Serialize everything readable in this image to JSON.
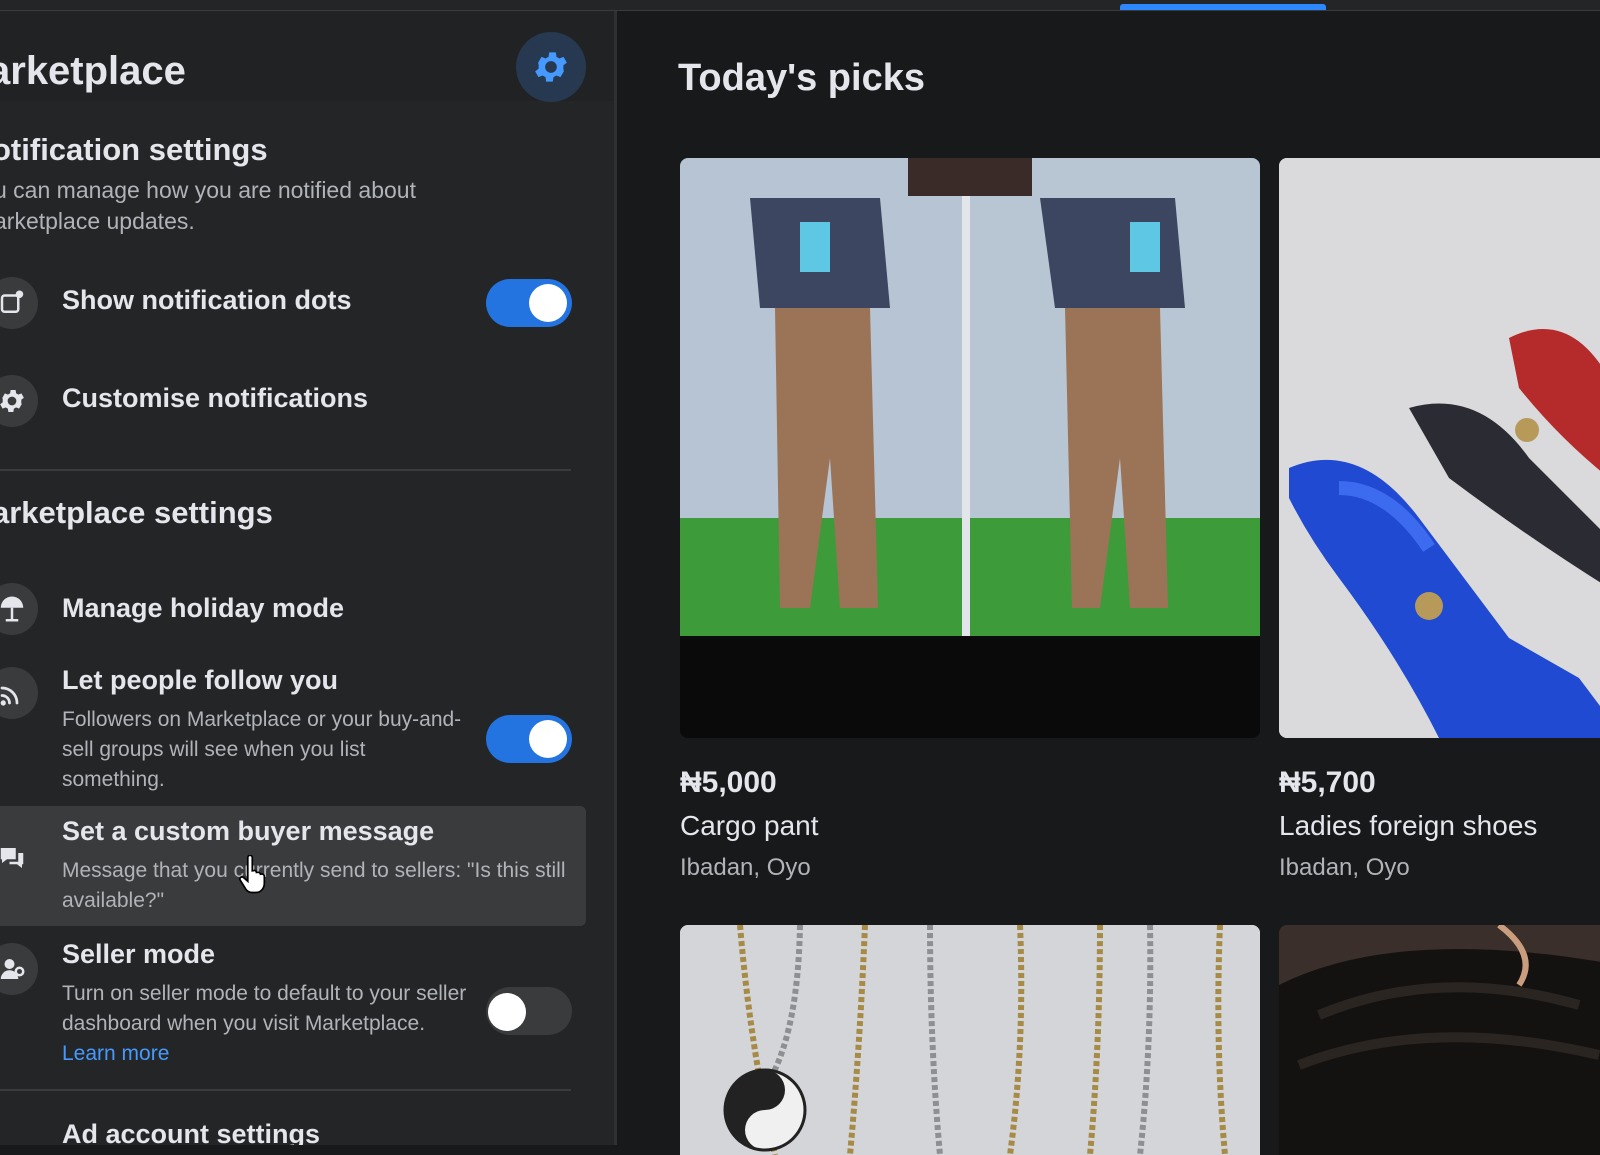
{
  "panel": {
    "title": "arketplace",
    "notification_section": {
      "title": "otification settings",
      "desc_line1": "u can manage how you are notified about",
      "desc_line2": "arketplace updates."
    },
    "notification_rows": [
      {
        "label": "Show notification dots",
        "toggle": "on",
        "icon": "notification-dot-icon"
      },
      {
        "label": "Customise notifications",
        "icon": "gear-icon"
      }
    ],
    "marketplace_section": {
      "title": "arketplace settings"
    },
    "marketplace_rows": [
      {
        "label": "Manage holiday mode",
        "icon": "beach-umbrella-icon"
      },
      {
        "label": "Let people follow you",
        "desc": "Followers on Marketplace or your buy-and-sell groups will see when you list something.",
        "toggle": "on",
        "icon": "follow-signal-icon"
      },
      {
        "label": "Set a custom buyer message",
        "desc": "Message that you currently send to sellers: \"Is this still available?\"",
        "icon": "chat-bubbles-icon"
      },
      {
        "label": "Seller mode",
        "desc": "Turn on seller mode to default to your seller dashboard when you visit Marketplace.",
        "link": "Learn more",
        "toggle": "off",
        "icon": "seller-person-icon"
      }
    ],
    "ad_section": {
      "title": "Ad account settings"
    }
  },
  "picks": {
    "title": "Today's picks",
    "items": [
      {
        "price": "₦5,000",
        "title": "Cargo pant",
        "location": "Ibadan, Oyo"
      },
      {
        "price": "₦5,700",
        "title": "Ladies foreign shoes",
        "location": "Ibadan, Oyo"
      }
    ]
  },
  "colors": {
    "accent": "#2374e1",
    "background": "#18191a",
    "panel": "#242526",
    "link": "#4599ff"
  }
}
